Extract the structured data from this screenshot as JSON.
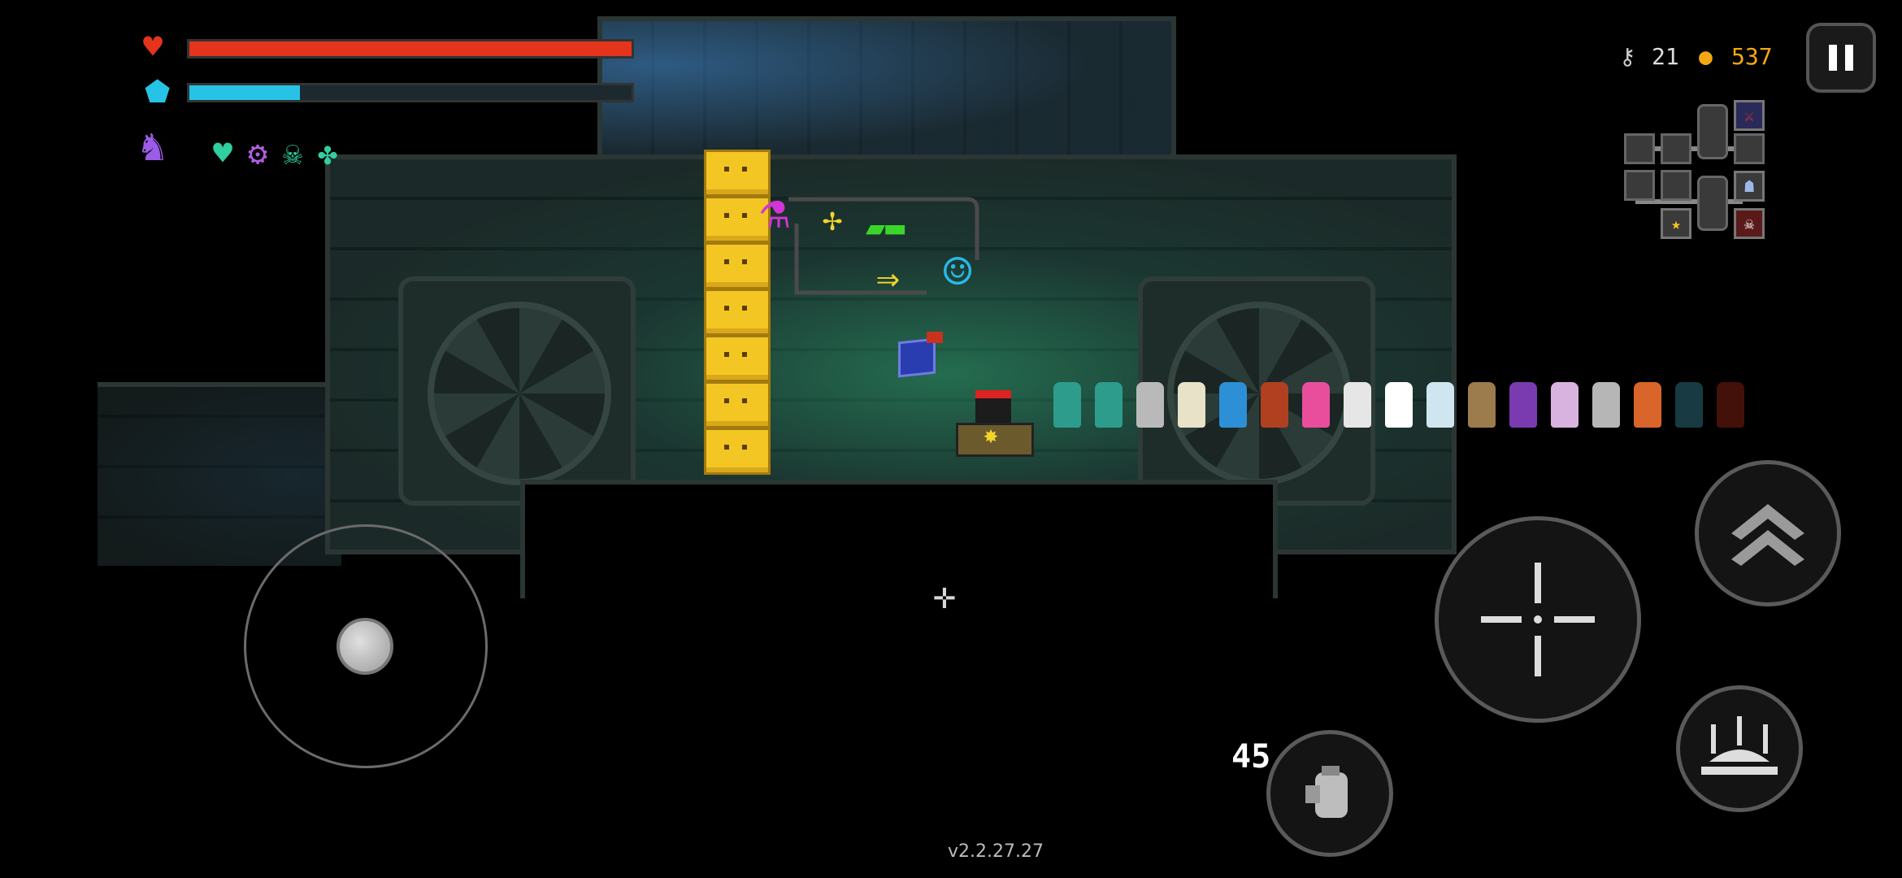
{
  "hud": {
    "health": {
      "fraction": 1.0,
      "color": "#e4341c",
      "icon": "heart-icon"
    },
    "armor": {
      "fraction": 0.25,
      "color": "#27c3e6",
      "icon": "shield-icon"
    },
    "character_icon": "hooded-character-icon",
    "buffs": [
      {
        "icon": "heart-buff-icon",
        "glyph": "♥",
        "color": "#2fcf9f"
      },
      {
        "icon": "gear-buff-icon",
        "glyph": "⚙",
        "color": "#b05ee0"
      },
      {
        "icon": "skull-buff-icon",
        "glyph": "☠",
        "color": "#2fcf9f"
      },
      {
        "icon": "clover-buff-icon",
        "glyph": "✤",
        "color": "#2fcf9f"
      }
    ]
  },
  "counters": {
    "keys": "21",
    "gems": "537",
    "key_icon": "key-icon",
    "gem_icon": "coin-icon",
    "gem_color": "#f3a712"
  },
  "minimap": {
    "rooms": 9,
    "icons": [
      "crossed-swords-icon",
      "robot-icon",
      "star-icon",
      "skull-icon"
    ]
  },
  "world": {
    "crate_stack_count": 7,
    "neon_sign": [
      "potion-sign-icon",
      "sparkle-sign-icon",
      "gun-sign-icon",
      "arrow-sign-icon",
      "robot-head-sign-icon"
    ],
    "floor_item": "blue-cube-item",
    "followers": [
      "#2e9c8c",
      "#2e9c8c",
      "#b9b9b9",
      "#e8e2c8",
      "#2d8fd6",
      "#b04020",
      "#e94e9d",
      "#e6e6e6",
      "#ffffff",
      "#cfe6f0",
      "#9c7b4c",
      "#7a3bb0",
      "#d9b3e0",
      "#b6b6b6",
      "#d9652a",
      "#2a6a7a",
      "#7a1f10"
    ]
  },
  "controls": {
    "ammo": "45",
    "joystick": "movement-joystick",
    "attack_icon": "crosshair-icon",
    "skill_icon": "double-chevron-up-icon",
    "ultimate_icon": "turret-icon",
    "weapon_icon": "grenade-fist-icon"
  },
  "version": "v2.2.27.27"
}
